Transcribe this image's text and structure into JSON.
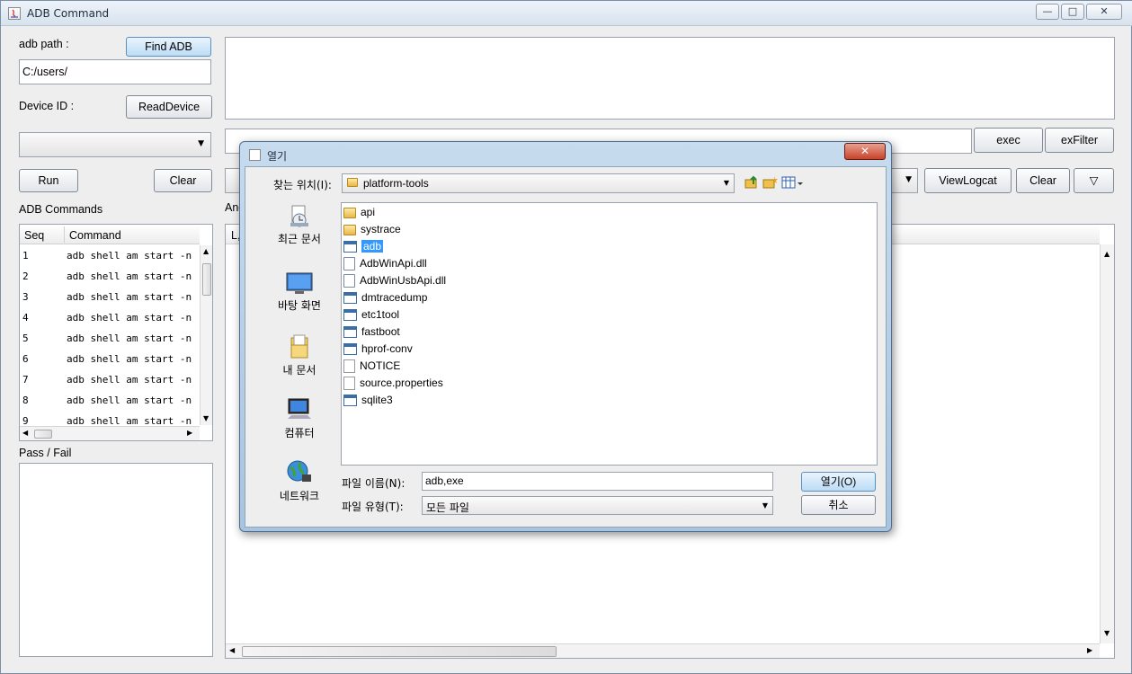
{
  "window": {
    "title": "ADB Command",
    "controls": [
      "—",
      "□",
      "✕"
    ]
  },
  "left": {
    "adb_path_label": "adb path :",
    "find_adb": "Find ADB",
    "adb_path_value": "C:/users/",
    "device_id_label": "Device ID :",
    "read_device": "ReadDevice",
    "run": "Run",
    "clear": "Clear",
    "adb_commands_label": "ADB Commands",
    "table": {
      "headers": [
        "Seq",
        "Command"
      ],
      "rows": [
        {
          "seq": "1",
          "cmd": "adb shell am start -n"
        },
        {
          "seq": "2",
          "cmd": "adb shell am start -n"
        },
        {
          "seq": "3",
          "cmd": "adb shell am start -n"
        },
        {
          "seq": "4",
          "cmd": "adb shell am start -n"
        },
        {
          "seq": "5",
          "cmd": "adb shell am start -n"
        },
        {
          "seq": "6",
          "cmd": "adb shell am start -n"
        },
        {
          "seq": "7",
          "cmd": "adb shell am start -n"
        },
        {
          "seq": "8",
          "cmd": "adb shell am start -n"
        },
        {
          "seq": "9",
          "cmd": "adb shell am start -n"
        }
      ]
    },
    "pass_fail_label": "Pass / Fail"
  },
  "right": {
    "exec": "exec",
    "exfilter": "exFilter",
    "viewlogcat": "ViewLogcat",
    "clear": "Clear",
    "down_arrow": "▽",
    "partial_label": "And",
    "log_header_partial": "L,"
  },
  "dialog": {
    "title": "열기",
    "close": "✕",
    "look_in_label": "찾는 위치(I):",
    "look_in_value": "platform-tools",
    "sidebar": [
      {
        "label": "최근 문서",
        "icon": "recent-docs-icon"
      },
      {
        "label": "바탕 화면",
        "icon": "desktop-icon"
      },
      {
        "label": "내 문서",
        "icon": "my-documents-icon"
      },
      {
        "label": "컴퓨터",
        "icon": "computer-icon"
      },
      {
        "label": "네트워크",
        "icon": "network-icon"
      }
    ],
    "files": [
      {
        "name": "api",
        "type": "folder"
      },
      {
        "name": "systrace",
        "type": "folder"
      },
      {
        "name": "adb",
        "type": "exe",
        "selected": true
      },
      {
        "name": "AdbWinApi.dll",
        "type": "dll"
      },
      {
        "name": "AdbWinUsbApi.dll",
        "type": "dll"
      },
      {
        "name": "dmtracedump",
        "type": "exe"
      },
      {
        "name": "etc1tool",
        "type": "exe"
      },
      {
        "name": "fastboot",
        "type": "exe"
      },
      {
        "name": "hprof-conv",
        "type": "exe"
      },
      {
        "name": "NOTICE",
        "type": "doc"
      },
      {
        "name": "source.properties",
        "type": "doc"
      },
      {
        "name": "sqlite3",
        "type": "exe"
      }
    ],
    "filename_label": "파일 이름(N):",
    "filename_value": "adb,exe",
    "filetype_label": "파일 유형(T):",
    "filetype_value": "모든 파일",
    "open": "열기(O)",
    "cancel": "취소"
  }
}
